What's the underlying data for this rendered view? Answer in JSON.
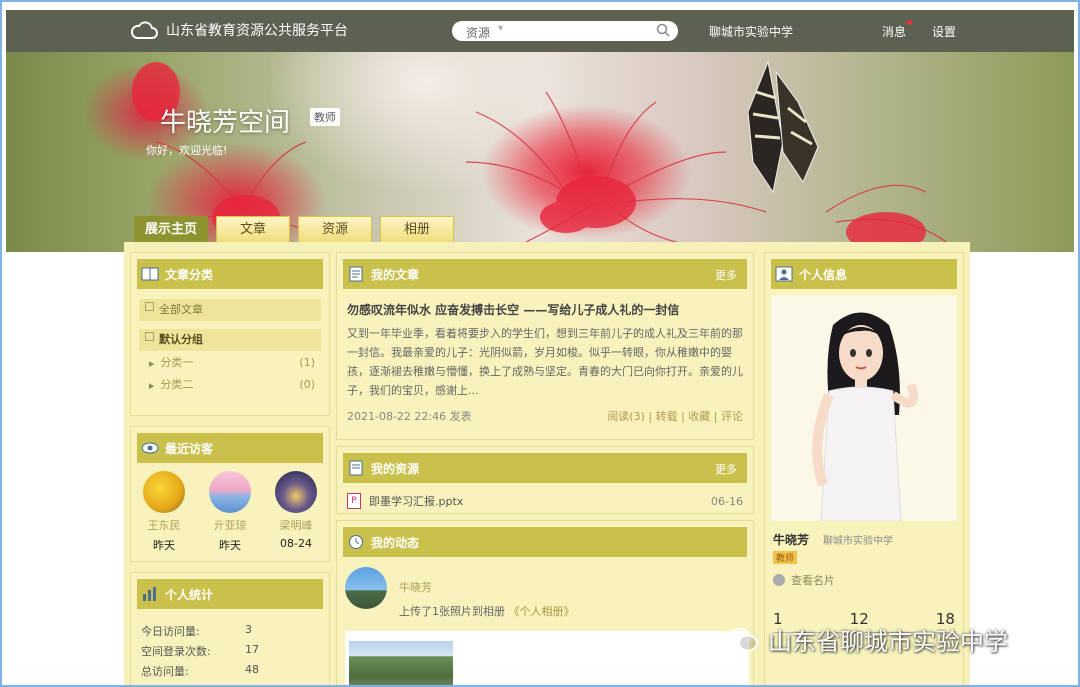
{
  "header": {
    "site_name": "山东省教育资源公共服务平台",
    "search_category": "资源",
    "school_link": "聊城市实验中学",
    "messages": "消息",
    "settings": "设置"
  },
  "banner": {
    "title": "牛晓芳空间",
    "role_badge": "教师",
    "welcome": "你好，欢迎光临!"
  },
  "tabs": [
    {
      "label": "展示主页",
      "active": true
    },
    {
      "label": "文章",
      "active": false
    },
    {
      "label": "资源",
      "active": false
    },
    {
      "label": "相册",
      "active": false
    }
  ],
  "categories": {
    "title": "文章分类",
    "all": "全部文章",
    "group": "默认分组",
    "items": [
      {
        "label": "分类一",
        "count": "(1)"
      },
      {
        "label": "分类二",
        "count": "(0)"
      }
    ]
  },
  "visitors": {
    "title": "最近访客",
    "items": [
      {
        "name": "王东民",
        "time": "昨天"
      },
      {
        "name": "亓亚琼",
        "time": "昨天"
      },
      {
        "name": "梁明峰",
        "time": "08-24"
      }
    ]
  },
  "stats": {
    "title": "个人统计",
    "rows": [
      {
        "label": "今日访问量:",
        "value": "3"
      },
      {
        "label": "空间登录次数:",
        "value": "17"
      },
      {
        "label": "总访问量:",
        "value": "48"
      }
    ]
  },
  "articles": {
    "title": "我的文章",
    "more": "更多",
    "item": {
      "title": "勿感叹流年似水 应奋发搏击长空 ——写给儿子成人礼的一封信",
      "excerpt": "又到一年毕业季，看着将要步入的学生们，想到三年前儿子的成人礼及三年前的那一封信。我最亲爱的儿子：光阴似箭，岁月如梭。似乎一转眼，你从稚嫩中的婴孩，逐渐褪去稚嫩与懵懂，换上了成熟与坚定。青春的大门已向你打开。亲爱的儿子，我们的宝贝，感谢上...",
      "date": "2021-08-22 22:46 发表",
      "actions": "阅读(3) | 转载 | 收藏 | 评论"
    }
  },
  "resources": {
    "title": "我的资源",
    "more": "更多",
    "item": {
      "name": "即墨学习汇报.pptx",
      "date": "06-16"
    }
  },
  "dynamics": {
    "title": "我的动态",
    "user": "牛晓芳",
    "action_prefix": "上传了1张照片到相册",
    "album": "《个人相册》"
  },
  "profile": {
    "title": "个人信息",
    "name": "牛晓芳",
    "school": "聊城市实验中学",
    "role": "教师",
    "card_link": "查看名片",
    "counts": [
      "1",
      "12",
      "18"
    ]
  },
  "watermark": "山东省聊城市实验中学",
  "colors": {
    "topbar": "#5c6151",
    "panel_header": "#c9c14c",
    "tab_active": "#8e932f",
    "content_bg": "#f6f1b8"
  }
}
